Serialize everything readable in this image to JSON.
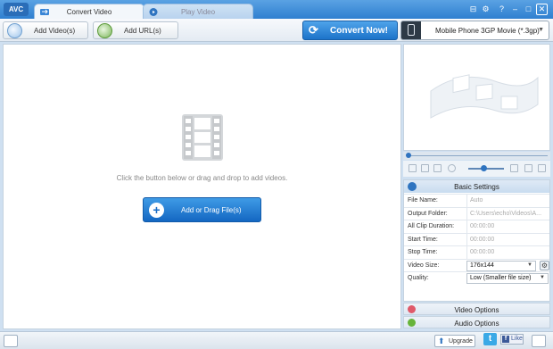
{
  "app": {
    "logo": "AVC"
  },
  "tabs": [
    {
      "label": "Convert Video",
      "active": true
    },
    {
      "label": "Play Video",
      "active": false
    }
  ],
  "window_buttons": {
    "minimize": "–",
    "maximize": "□",
    "close": "✕",
    "help": "?",
    "settings": "⚙",
    "media": "⊟"
  },
  "toolbar": {
    "add_videos": "Add Video(s)",
    "add_urls": "Add URL(s)",
    "convert_now": "Convert Now!",
    "profile": "Mobile Phone 3GP Movie (*.3gp)"
  },
  "main": {
    "hint": "Click the button below or drag and drop to add videos.",
    "add_button": "Add or Drag File(s)"
  },
  "settings": {
    "title": "Basic Settings",
    "rows": [
      {
        "key": "File Name:",
        "value": "Auto"
      },
      {
        "key": "Output Folder:",
        "value": "C:\\Users\\echo\\Videos\\A..."
      },
      {
        "key": "All Clip Duration:",
        "value": "00:00:00"
      },
      {
        "key": "Start Time:",
        "value": "00:00:00"
      },
      {
        "key": "Stop Time:",
        "value": "00:00:00"
      },
      {
        "key": "Video Size:",
        "value": "176x144"
      },
      {
        "key": "Quality:",
        "value": "Low (Smaller file size)"
      }
    ]
  },
  "options": {
    "video": "Video Options",
    "audio": "Audio Options"
  },
  "statusbar": {
    "upgrade": "Upgrade",
    "like": "Like"
  },
  "colors": {
    "accent": "#1c73c9",
    "titlebar": "#2f7fd0"
  }
}
